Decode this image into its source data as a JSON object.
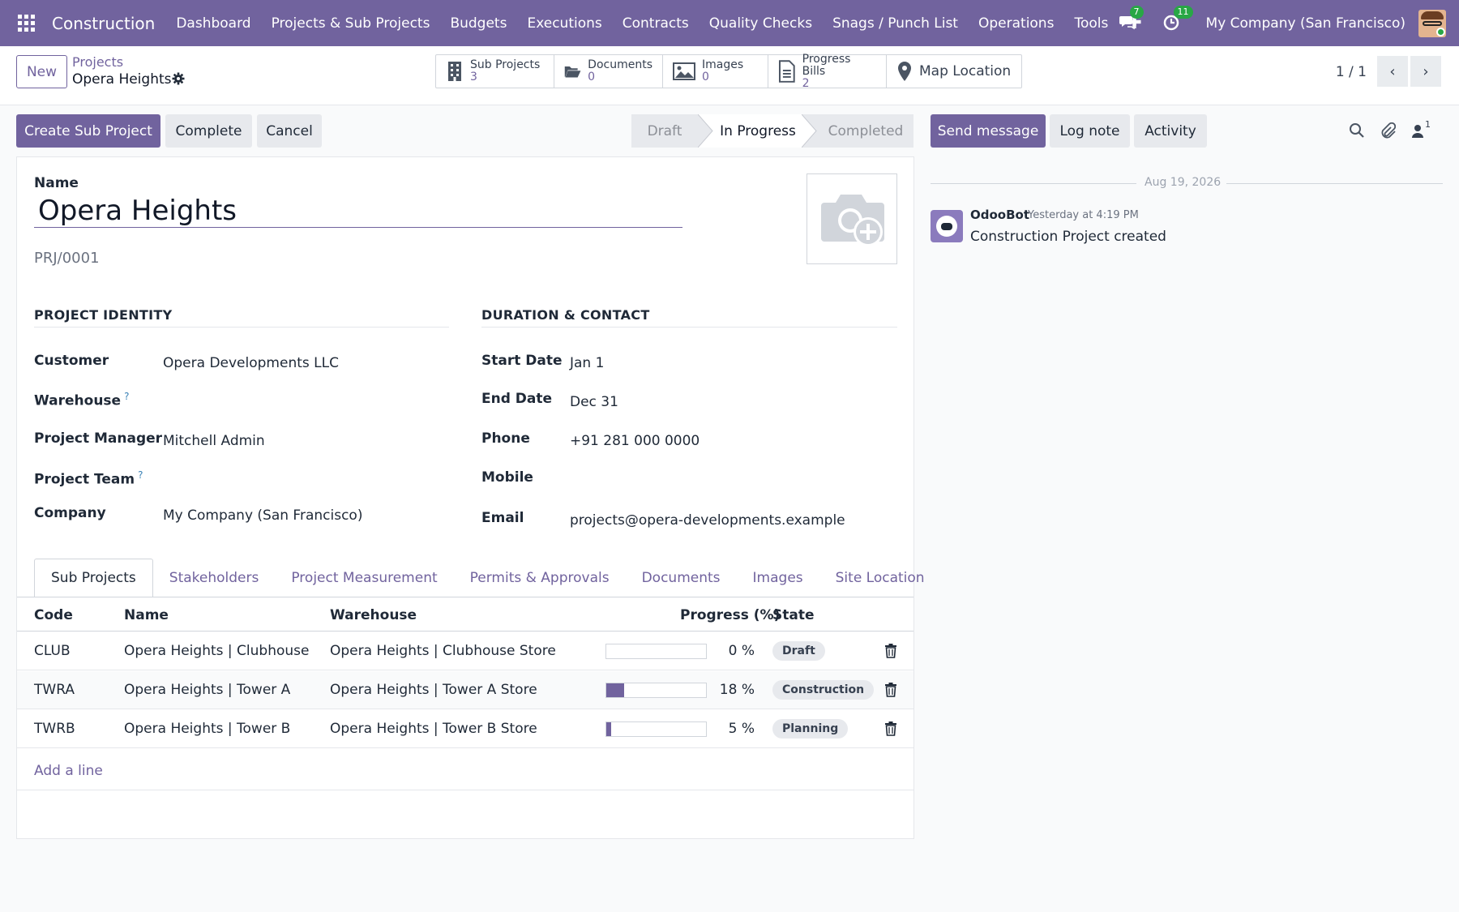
{
  "navbar": {
    "app_name": "Construction",
    "menu": [
      "Dashboard",
      "Projects & Sub Projects",
      "Budgets",
      "Executions",
      "Contracts",
      "Quality Checks",
      "Snags / Punch List",
      "Operations",
      "Tools"
    ],
    "messages_count": "7",
    "activities_count": "11",
    "company": "My Company (San Francisco)"
  },
  "control": {
    "new_label": "New",
    "breadcrumb_parent": "Projects",
    "breadcrumb_current": "Opera Heights",
    "smart_buttons": [
      {
        "label": "Sub Projects",
        "value": "3"
      },
      {
        "label": "Documents",
        "value": "0"
      },
      {
        "label": "Images",
        "value": "0"
      },
      {
        "label": "Progress Bills",
        "value": "2"
      }
    ],
    "map_location": "Map Location",
    "pager": "1 / 1"
  },
  "actions": {
    "create_sub_project": "Create Sub Project",
    "complete": "Complete",
    "cancel": "Cancel"
  },
  "status": {
    "stages": [
      "Draft",
      "In Progress",
      "Completed"
    ],
    "current": "In Progress"
  },
  "form": {
    "name_label": "Name",
    "name": "Opera Heights",
    "reference": "PRJ/0001",
    "identity_title": "PROJECT IDENTITY",
    "duration_title": "DURATION & CONTACT",
    "identity": {
      "customer_label": "Customer",
      "customer": "Opera Developments LLC",
      "warehouse_label": "Warehouse",
      "warehouse_help": "?",
      "manager_label": "Project Manager",
      "manager": "Mitchell Admin",
      "team_label": "Project Team",
      "team_help": "?",
      "company_label": "Company",
      "company": "My Company (San Francisco)"
    },
    "contact": {
      "start_label": "Start Date",
      "start": "Jan 1",
      "end_label": "End Date",
      "end": "Dec 31",
      "phone_label": "Phone",
      "phone": "+91 281 000 0000",
      "mobile_label": "Mobile",
      "email_label": "Email",
      "email": "projects@opera-developments.example"
    }
  },
  "tabs": [
    "Sub Projects",
    "Stakeholders",
    "Project Measurement",
    "Permits & Approvals",
    "Documents",
    "Images",
    "Site Location"
  ],
  "table": {
    "headers": {
      "code": "Code",
      "name": "Name",
      "warehouse": "Warehouse",
      "progress": "Progress (%)",
      "state": "State"
    },
    "rows": [
      {
        "code": "CLUB",
        "name": "Opera Heights | Clubhouse",
        "warehouse": "Opera Heights | Clubhouse Store",
        "progress": 0,
        "progress_text": "0 %",
        "state": "Draft"
      },
      {
        "code": "TWRA",
        "name": "Opera Heights | Tower A",
        "warehouse": "Opera Heights | Tower A Store",
        "progress": 18,
        "progress_text": "18 %",
        "state": "Construction"
      },
      {
        "code": "TWRB",
        "name": "Opera Heights | Tower B",
        "warehouse": "Opera Heights | Tower B Store",
        "progress": 5,
        "progress_text": "5 %",
        "state": "Planning"
      }
    ],
    "add_line": "Add a line"
  },
  "chatter": {
    "send_message": "Send message",
    "log_note": "Log note",
    "activity": "Activity",
    "followers_count": "1",
    "date": "Aug 19, 2026",
    "message": {
      "author": "OdooBot",
      "time": "Yesterday at 4:19 PM",
      "body": "Construction Project created"
    }
  },
  "colors": {
    "primary": "#71639e",
    "badge": "#28a745"
  }
}
